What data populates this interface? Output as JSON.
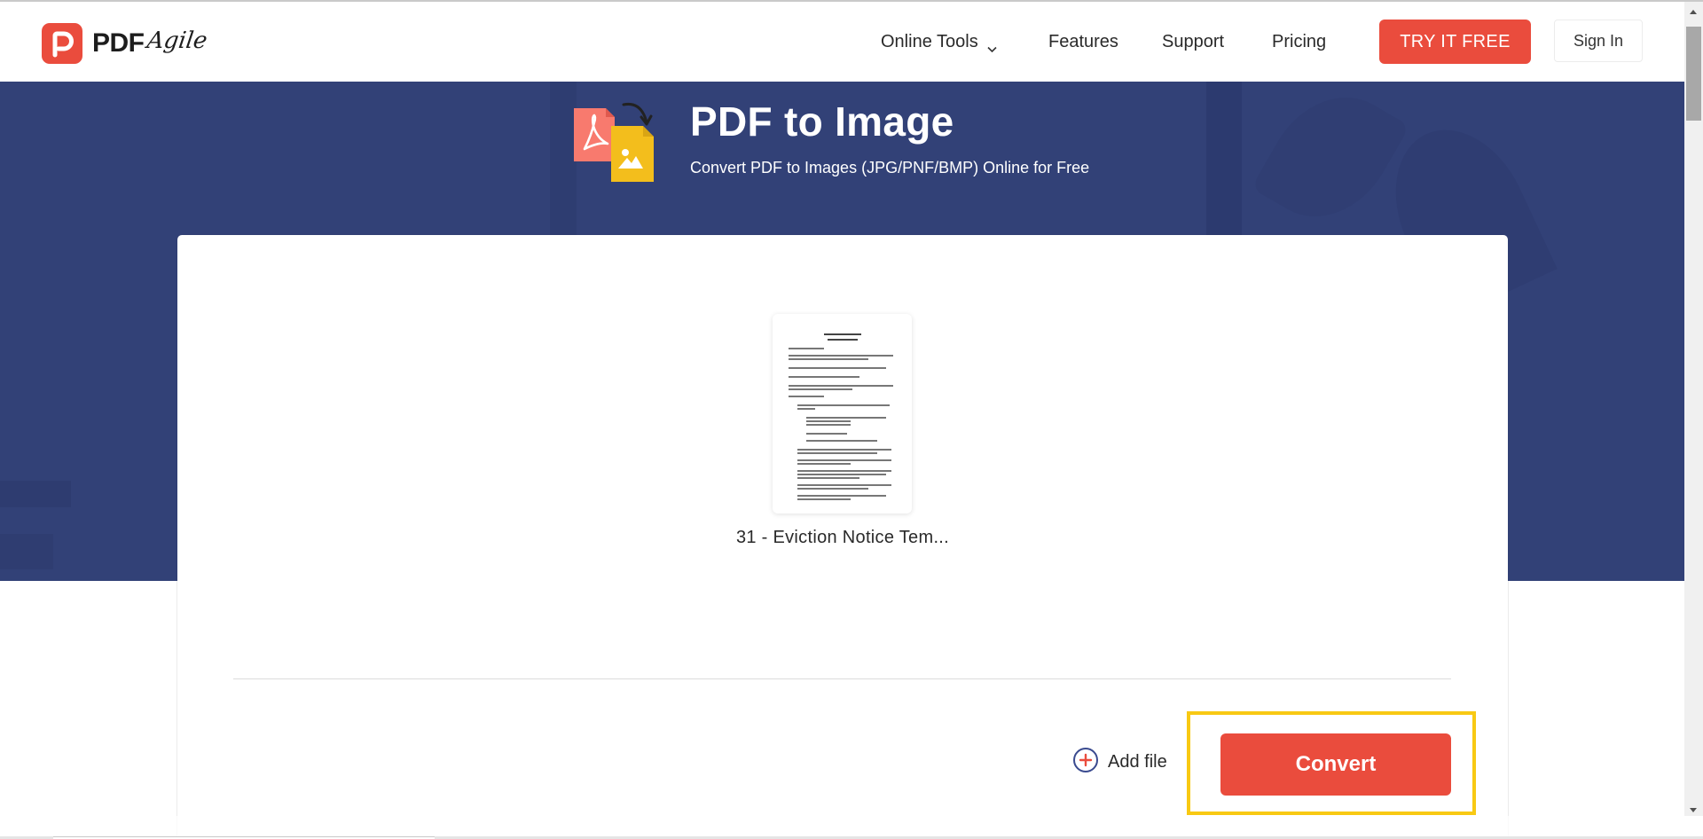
{
  "header": {
    "logo": {
      "brand_bold": "PDF",
      "brand_script": "Agile",
      "icon": "pdfagile-logo-icon"
    },
    "nav": [
      {
        "label": "Online Tools",
        "has_dropdown": true
      },
      {
        "label": "Features"
      },
      {
        "label": "Support"
      },
      {
        "label": "Pricing"
      }
    ],
    "try_button": "TRY IT FREE",
    "signin_button": "Sign In"
  },
  "hero": {
    "icon": "pdf-to-image-icon",
    "title": "PDF to Image",
    "subtitle": "Convert PDF to Images (JPG/PNF/BMP) Online for Free"
  },
  "card": {
    "files": [
      {
        "name": "31 - Eviction Notice Tem...",
        "thumbnail": "document-thumbnail"
      }
    ],
    "add_file_label": "Add file",
    "convert_button": "Convert"
  },
  "colors": {
    "brand_red": "#ea4c3d",
    "hero_navy": "#324177",
    "highlight_yellow": "#f8c913",
    "pdf_pink": "#f87a6e",
    "image_yellow": "#f3be1c"
  }
}
